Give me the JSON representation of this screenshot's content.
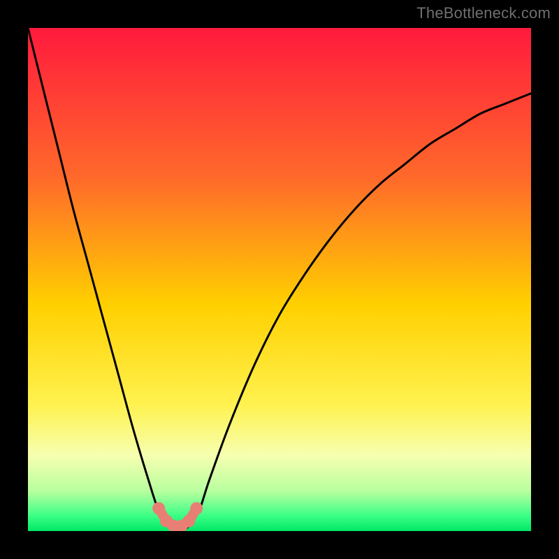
{
  "watermark": "TheBottleneck.com",
  "chart_data": {
    "type": "line",
    "title": "",
    "xlabel": "",
    "ylabel": "",
    "xlim": [
      0,
      100
    ],
    "ylim": [
      0,
      100
    ],
    "grid": false,
    "legend": false,
    "background_gradient": {
      "stops": [
        {
          "offset": 0.0,
          "color": "#ff1a3d"
        },
        {
          "offset": 0.3,
          "color": "#ff6a2a"
        },
        {
          "offset": 0.55,
          "color": "#ffd000"
        },
        {
          "offset": 0.75,
          "color": "#fff250"
        },
        {
          "offset": 0.85,
          "color": "#f6ffb0"
        },
        {
          "offset": 0.92,
          "color": "#b9ff9f"
        },
        {
          "offset": 0.97,
          "color": "#3bff86"
        },
        {
          "offset": 1.0,
          "color": "#00e765"
        }
      ]
    },
    "series": [
      {
        "name": "bottleneck-curve",
        "x": [
          0,
          3,
          6,
          9,
          12,
          15,
          18,
          21,
          24,
          26,
          28,
          30,
          32,
          34,
          36,
          40,
          45,
          50,
          55,
          60,
          65,
          70,
          75,
          80,
          85,
          90,
          95,
          100
        ],
        "values": [
          100,
          88,
          76,
          64,
          53,
          42,
          31,
          20,
          10,
          4,
          1,
          0,
          1,
          4,
          10,
          21,
          33,
          43,
          51,
          58,
          64,
          69,
          73,
          77,
          80,
          83,
          85,
          87
        ]
      }
    ],
    "marker_region": {
      "name": "optimal-range",
      "color": "#e77f74",
      "points": [
        {
          "x": 26.0,
          "y": 4.5
        },
        {
          "x": 27.5,
          "y": 2.0
        },
        {
          "x": 29.0,
          "y": 1.0
        },
        {
          "x": 30.5,
          "y": 1.0
        },
        {
          "x": 32.0,
          "y": 2.0
        },
        {
          "x": 33.5,
          "y": 4.5
        }
      ]
    }
  }
}
